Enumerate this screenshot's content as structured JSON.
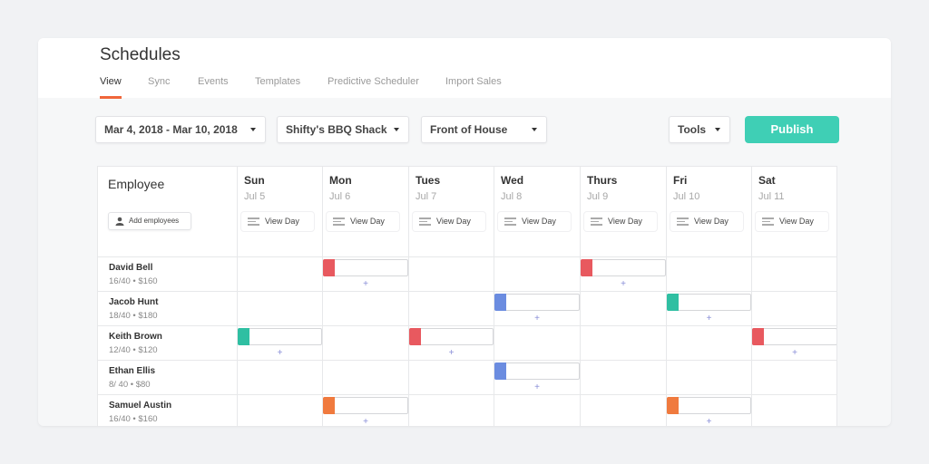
{
  "page": {
    "title": "Schedules"
  },
  "tabs": [
    {
      "label": "View",
      "active": true
    },
    {
      "label": "Sync"
    },
    {
      "label": "Events"
    },
    {
      "label": "Templates"
    },
    {
      "label": "Predictive Scheduler"
    },
    {
      "label": "Import Sales"
    }
  ],
  "toolbar": {
    "date_range": "Mar 4, 2018 - Mar 10, 2018",
    "location": "Shifty's BBQ Shack",
    "department": "Front of House",
    "tools": "Tools",
    "publish": "Publish"
  },
  "grid": {
    "employee_header": "Employee",
    "add_employees": "Add employees",
    "view_day_label": "View Day",
    "add_shift_symbol": "+",
    "days": [
      {
        "name": "Sun",
        "date": "Jul 5"
      },
      {
        "name": "Mon",
        "date": "Jul 6"
      },
      {
        "name": "Tues",
        "date": "Jul 7"
      },
      {
        "name": "Wed",
        "date": "Jul 8"
      },
      {
        "name": "Thurs",
        "date": "Jul 9"
      },
      {
        "name": "Fri",
        "date": "Jul 10"
      },
      {
        "name": "Sat",
        "date": "Jul 11"
      }
    ]
  },
  "employees": [
    {
      "name": "David Bell",
      "meta": "16/40 • $160",
      "shifts": [
        {
          "day": 1,
          "color": "#e8595f"
        },
        {
          "day": 4,
          "color": "#e8595f"
        }
      ]
    },
    {
      "name": "Jacob Hunt",
      "meta": "18/40 • $180",
      "shifts": [
        {
          "day": 3,
          "color": "#6b8ce0"
        },
        {
          "day": 5,
          "color": "#2fbfa2"
        }
      ]
    },
    {
      "name": "Keith Brown",
      "meta": "12/40 • $120",
      "shifts": [
        {
          "day": 0,
          "color": "#2fbfa2"
        },
        {
          "day": 2,
          "color": "#e8595f"
        },
        {
          "day": 6,
          "color": "#e8595f"
        }
      ]
    },
    {
      "name": "Ethan Ellis",
      "meta": "8/ 40 • $80",
      "shifts": [
        {
          "day": 3,
          "color": "#6b8ce0"
        }
      ]
    },
    {
      "name": "Samuel Austin",
      "meta": "16/40 • $160",
      "shifts": [
        {
          "day": 1,
          "color": "#f07a3e"
        },
        {
          "day": 5,
          "color": "#f07a3e"
        }
      ]
    }
  ],
  "colors": {
    "accent": "#f0663a",
    "publish": "#3fcfb5",
    "plus": "#8a8fd8"
  }
}
